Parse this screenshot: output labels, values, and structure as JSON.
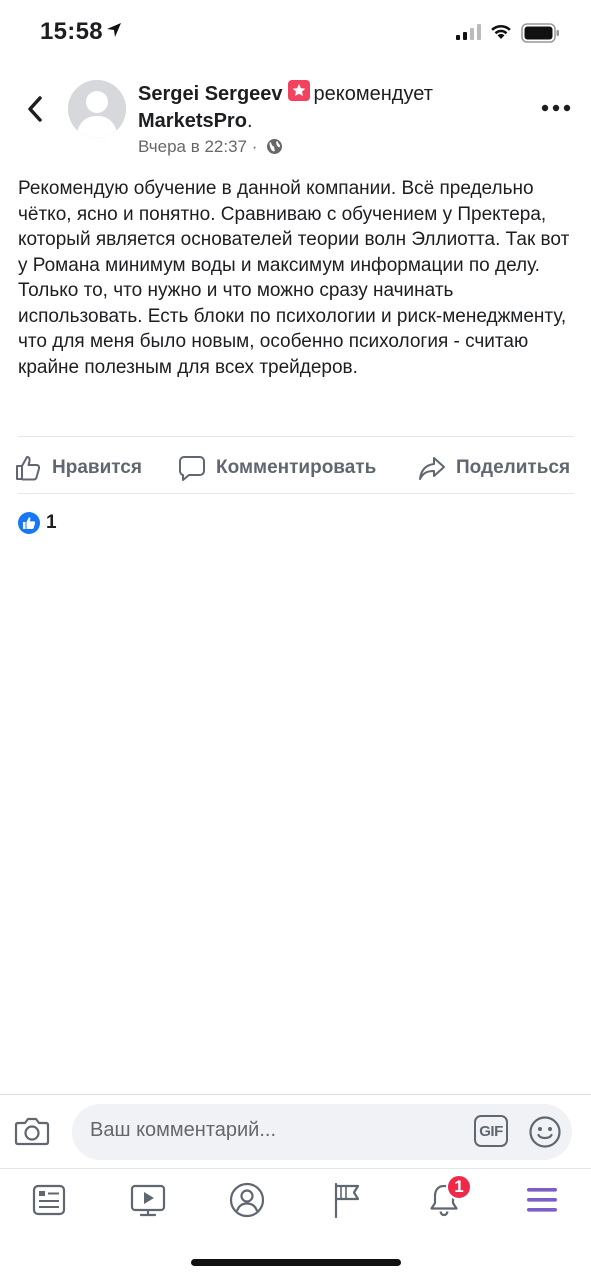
{
  "status_bar": {
    "time": "15:58",
    "icons": [
      "location-arrow-icon",
      "cellular-signal-icon",
      "wifi-icon",
      "battery-icon"
    ]
  },
  "post": {
    "author": "Sergei Sergeev",
    "action_verb": "рекомендует",
    "page_name": "MarketsPro",
    "page_suffix": ".",
    "timestamp": "Вчера в 22:37",
    "separator": "·",
    "privacy_icon": "globe-icon",
    "text": "Рекомендую обучение в данной компании. Всё предельно чётко, ясно и понятно. Сравниваю с обучением у Пректера, который является основателей теории волн Эллиотта. Так вот у Романа минимум воды и максимум информации по делу. Только то, что нужно и что можно сразу начинать использовать. Есть блоки по психологии и риск-менеджменту, что для меня было новым, особенно психология - считаю крайне полезным для всех трейдеров.",
    "actions": {
      "like": "Нравится",
      "comment": "Комментировать",
      "share": "Поделиться"
    },
    "reactions": {
      "type": "like",
      "count": "1"
    }
  },
  "comment_bar": {
    "placeholder": "Ваш комментарий...",
    "gif_label": "GIF"
  },
  "tab_bar": {
    "tabs": [
      "news-feed-icon",
      "watch-icon",
      "profile-icon",
      "pages-icon",
      "notifications-icon",
      "menu-icon"
    ],
    "notifications_badge": "1"
  },
  "colors": {
    "accent": "#1877f2",
    "menu_active": "#7b5fc7",
    "badge": "#f02849",
    "recommend_badge": "#f3425f"
  }
}
